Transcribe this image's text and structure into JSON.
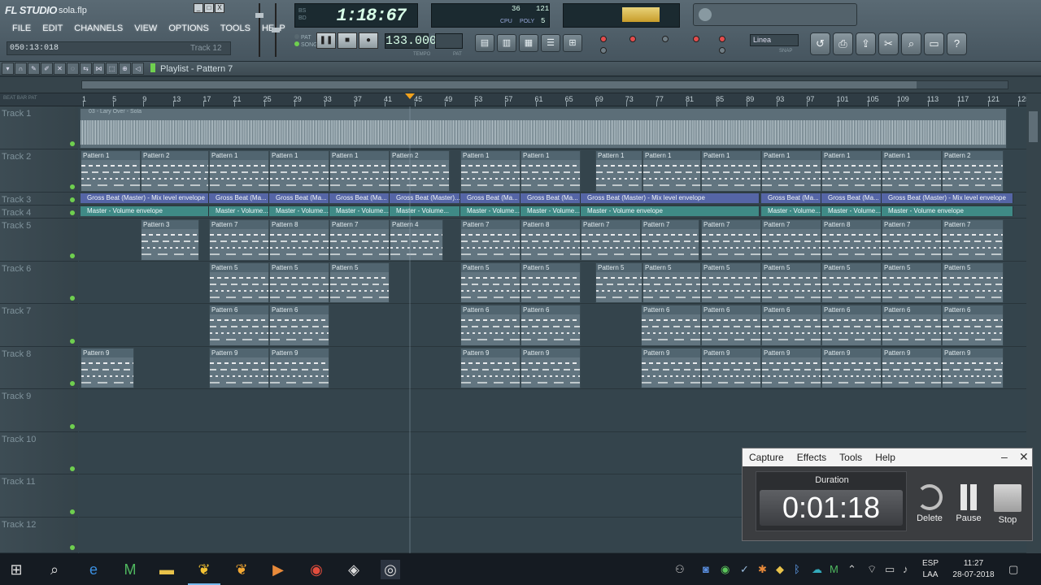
{
  "app": {
    "logo": "FL STUDIO",
    "filename": "sola.flp",
    "window_buttons": [
      "_",
      "□",
      "X"
    ]
  },
  "menu": [
    "FILE",
    "EDIT",
    "CHANNELS",
    "VIEW",
    "OPTIONS",
    "TOOLS",
    "HELP"
  ],
  "hint_bar": {
    "time": "050:13:018",
    "track": "Track 12"
  },
  "song_position": {
    "small_top": "BS",
    "small_bottom": "BD",
    "time": "1:18:67"
  },
  "modes": {
    "pat": "PAT",
    "song": "SONG"
  },
  "transport": {
    "pause": "❚❚",
    "stop": "■",
    "record": "●"
  },
  "tempo": {
    "value": "133.000",
    "label": "TEMPO"
  },
  "pattern_label": "PAT",
  "monitor": {
    "cpu_value": "36",
    "ram_value": "121",
    "poly_value": "5",
    "cpu_label": "CPU",
    "poly_label": "POLY"
  },
  "snap": {
    "value": "Linea",
    "label": "SNAP"
  },
  "playlist": {
    "title": "Playlist - Pattern 7",
    "ruler_left": "BEAT  BAR  PAT",
    "ruler": [
      "1",
      "5",
      "9",
      "13",
      "17",
      "21",
      "25",
      "29",
      "33",
      "37",
      "41",
      "45",
      "49",
      "53",
      "57",
      "61",
      "65",
      "69",
      "73",
      "77",
      "81",
      "85",
      "89",
      "93",
      "97",
      "101",
      "105",
      "109",
      "113",
      "117",
      "121",
      "125"
    ],
    "tracks": [
      "Track 1",
      "Track 2",
      "Track 3",
      "Track 4",
      "Track 5",
      "Track 6",
      "Track 7",
      "Track 8",
      "Track 9",
      "Track 10",
      "Track 11",
      "Track 12"
    ],
    "audio_clip_label": "03 - Lary Over - Sola",
    "clips": {
      "p1": "Pattern 1",
      "p2": "Pattern 2",
      "p3": "Pattern 3",
      "p4": "Pattern 4",
      "p5": "Pattern 5",
      "p6": "Pattern 6",
      "p7": "Pattern 7",
      "p8": "Pattern 8",
      "p9": "Pattern 9"
    },
    "env_gross_full": "Gross Beat (Master) - Mix level envelope",
    "env_gross_short": "Gross Beat (Ma...",
    "env_gross_mid": "Gross Beat (Master)...",
    "env_master": "Master - Volume envelope",
    "env_master_short": "Master - Volume..."
  },
  "capture": {
    "menu": [
      "Capture",
      "Effects",
      "Tools",
      "Help"
    ],
    "duration_label": "Duration",
    "duration": "0:01:18",
    "delete": "Delete",
    "pause": "Pause",
    "stop": "Stop"
  },
  "taskbar": {
    "lang_top": "ESP",
    "lang_bottom": "LAA",
    "time": "11:27",
    "date": "28-07-2018"
  }
}
